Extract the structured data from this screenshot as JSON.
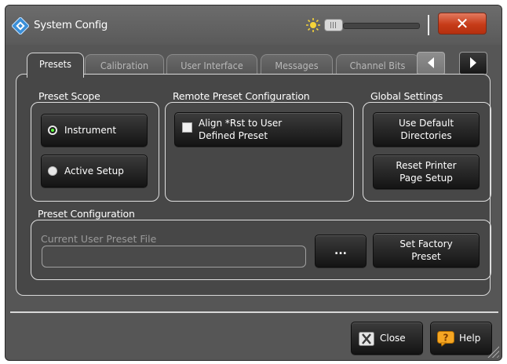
{
  "window": {
    "title": "System Config"
  },
  "tabs": [
    {
      "label": "Presets",
      "active": true
    },
    {
      "label": "Calibration"
    },
    {
      "label": "User Interface"
    },
    {
      "label": "Messages"
    },
    {
      "label": "Channel Bits"
    }
  ],
  "preset_scope": {
    "title": "Preset Scope",
    "options": [
      {
        "label": "Instrument",
        "selected": true
      },
      {
        "label": "Active Setup",
        "selected": false
      }
    ]
  },
  "remote_preset": {
    "title": "Remote Preset Configuration",
    "checkbox_line1": "Align *Rst to User",
    "checkbox_line2": "Defined Preset",
    "checked": false
  },
  "global_settings": {
    "title": "Global Settings",
    "use_default_line1": "Use Default",
    "use_default_line2": "Directories",
    "reset_printer_line1": "Reset Printer",
    "reset_printer_line2": "Page Setup"
  },
  "preset_config": {
    "title": "Preset Configuration",
    "file_label": "Current User Preset File",
    "file_value": "",
    "browse_label": "...",
    "factory_line1": "Set Factory",
    "factory_line2": "Preset"
  },
  "footer": {
    "close_label": "Close",
    "help_label": "Help"
  },
  "colors": {
    "close_accent": "#c63b18",
    "radio_on": "#5cff3c",
    "help_icon": "#f5a623"
  }
}
